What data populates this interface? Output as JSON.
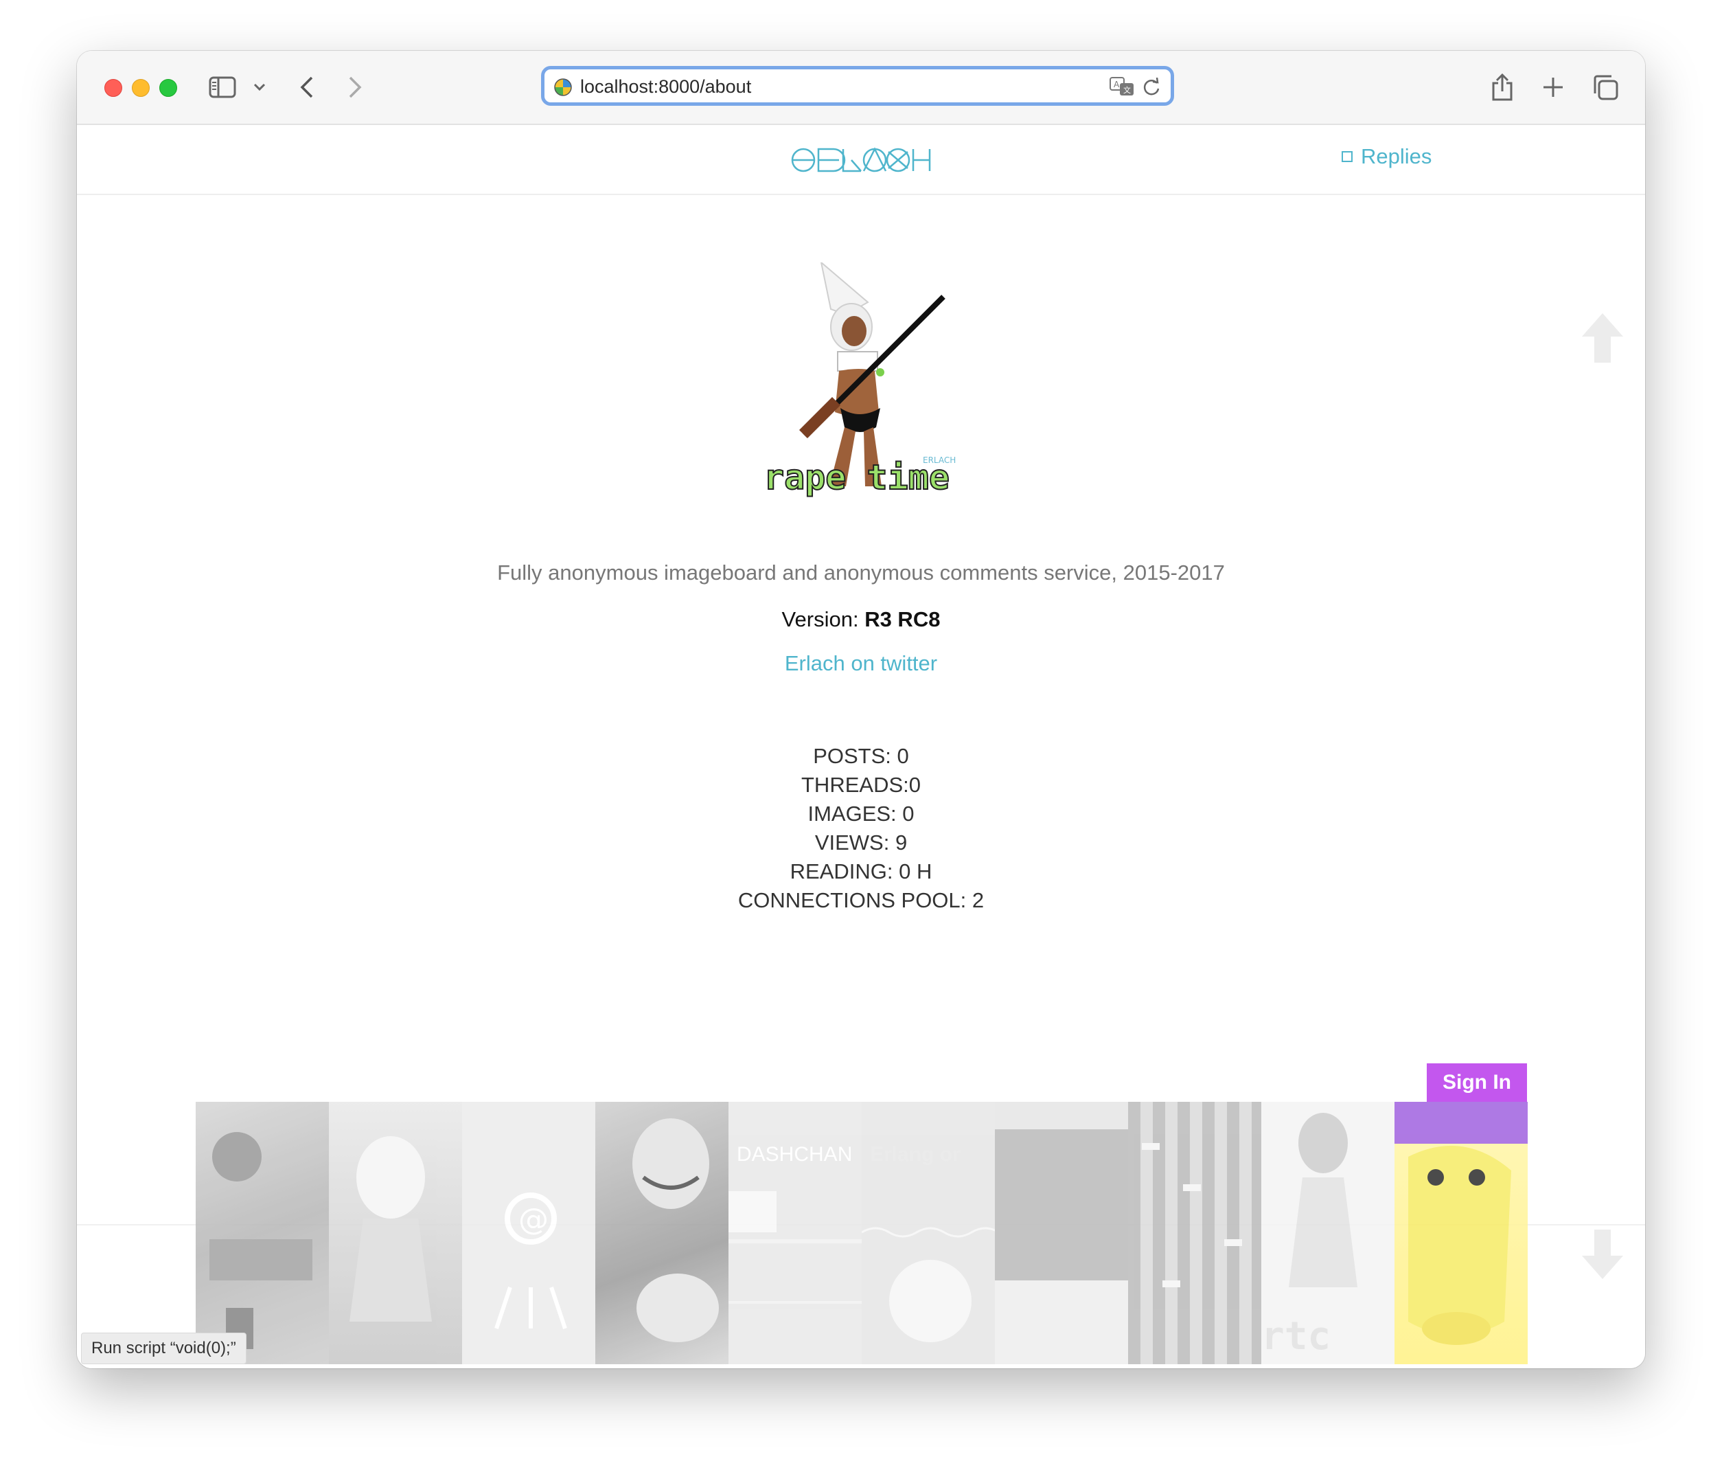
{
  "browser": {
    "url": "localhost:8000/about"
  },
  "site": {
    "logo_alt": "erlach",
    "replies_label": "Replies",
    "tagline": "Fully anonymous imageboard and anonymous comments service, 2015-2017",
    "version_prefix": "Version:",
    "version_value": "R3 RC8",
    "twitter_link": "Erlach on twitter",
    "stats": {
      "posts": "POSTS: 0",
      "threads": "THREADS:0",
      "images": "IMAGES: 0",
      "views": "VIEWS: 9",
      "reading": "READING: 0 H",
      "pool": "CONNECTIONS POOL: 2"
    },
    "mascot_text": "rape time",
    "mascot_signature": "ERLACH",
    "signin_label": "Sign In",
    "tiles": [
      {
        "name": "tile-1",
        "label": ""
      },
      {
        "name": "tile-2",
        "label": ""
      },
      {
        "name": "tile-3",
        "label": ""
      },
      {
        "name": "tile-4",
        "label": ""
      },
      {
        "name": "tile-5",
        "label": "DASHCHAN"
      },
      {
        "name": "tile-6",
        "label": "Erlang or"
      },
      {
        "name": "tile-7",
        "label": ""
      },
      {
        "name": "tile-8",
        "label": ""
      },
      {
        "name": "tile-9",
        "label": ""
      },
      {
        "name": "tile-10",
        "label": ""
      }
    ]
  },
  "status_bar": {
    "text": "Run script “void(0);”"
  },
  "colors": {
    "accent": "#4fb5cc",
    "signin": "#c357ee",
    "address_focus": "#79a7e8"
  }
}
